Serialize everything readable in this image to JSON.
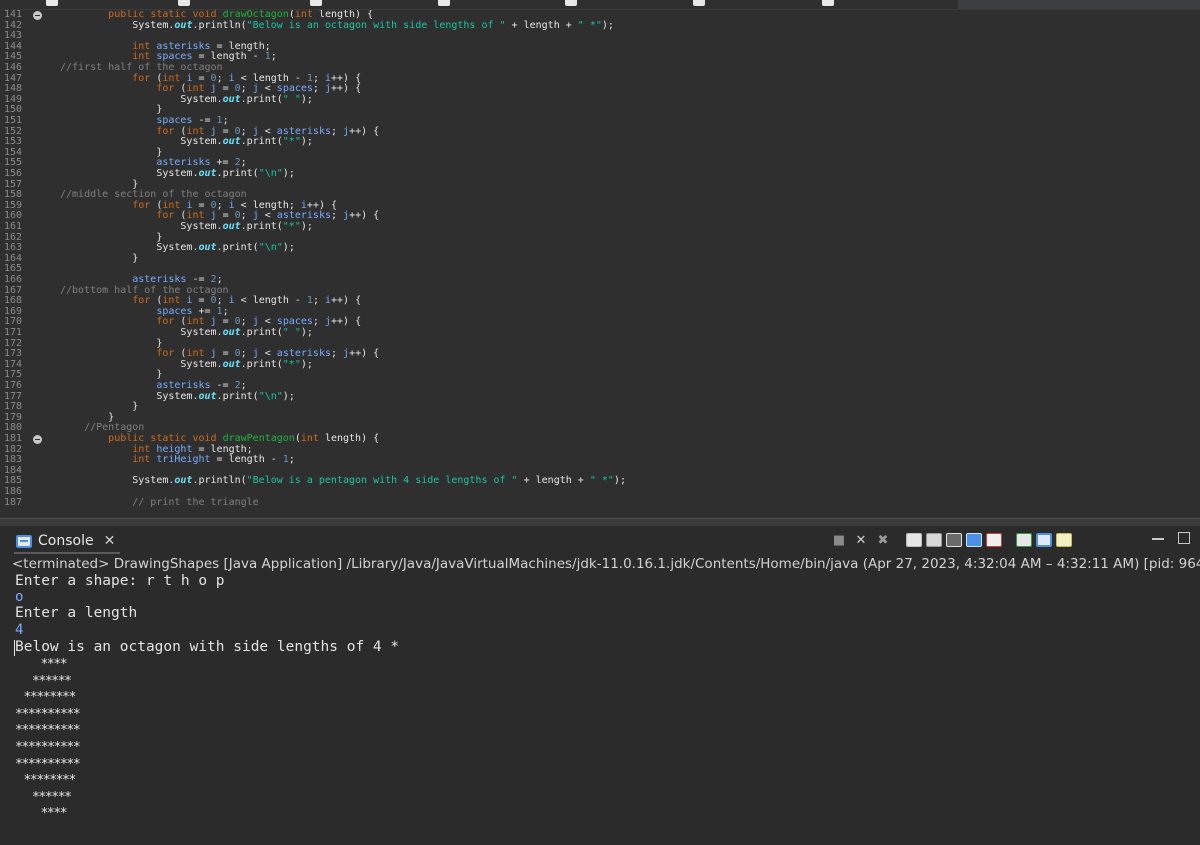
{
  "editor": {
    "lines": [
      {
        "n": "141",
        "fold": true,
        "html": "        <span class=\"kw\">public static void</span> <span class=\"fn\">drawOctagon</span>(<span class=\"ty\">int</span> length) {"
      },
      {
        "n": "142",
        "html": "            System.<span class=\"fld\">out</span>.println(<span class=\"str\">\"Below is an octagon with side lengths of \"</span> + length + <span class=\"str\">\" *\"</span>);"
      },
      {
        "n": "143",
        "html": ""
      },
      {
        "n": "144",
        "html": "            <span class=\"ty\">int</span> <span class=\"var\">asterisks</span> = length;"
      },
      {
        "n": "145",
        "html": "            <span class=\"ty\">int</span> <span class=\"var\">spaces</span> = length - <span class=\"num\">1</span>;"
      },
      {
        "n": "146",
        "html": "<span class=\"cmt\">//first half of the octagon</span>"
      },
      {
        "n": "147",
        "html": "            <span class=\"kw\">for</span> (<span class=\"ty\">int</span> <span class=\"var\">i</span> = <span class=\"num\">0</span>; <span class=\"var\">i</span> &lt; length - <span class=\"num\">1</span>; <span class=\"var\">i</span>++) {"
      },
      {
        "n": "148",
        "html": "                <span class=\"kw\">for</span> (<span class=\"ty\">int</span> <span class=\"var\">j</span> = <span class=\"num\">0</span>; <span class=\"var\">j</span> &lt; <span class=\"var\">spaces</span>; <span class=\"var\">j</span>++) {"
      },
      {
        "n": "149",
        "html": "                    System.<span class=\"fld\">out</span>.print(<span class=\"str\">\" \"</span>);"
      },
      {
        "n": "150",
        "html": "                }"
      },
      {
        "n": "151",
        "html": "                <span class=\"var\">spaces</span> -= <span class=\"num\">1</span>;"
      },
      {
        "n": "152",
        "html": "                <span class=\"kw\">for</span> (<span class=\"ty\">int</span> <span class=\"var\">j</span> = <span class=\"num\">0</span>; <span class=\"var\">j</span> &lt; <span class=\"var\">asterisks</span>; <span class=\"var\">j</span>++) {"
      },
      {
        "n": "153",
        "html": "                    System.<span class=\"fld\">out</span>.print(<span class=\"str\">\"*\"</span>);"
      },
      {
        "n": "154",
        "html": "                }"
      },
      {
        "n": "155",
        "html": "                <span class=\"var\">asterisks</span> += <span class=\"num\">2</span>;"
      },
      {
        "n": "156",
        "html": "                System.<span class=\"fld\">out</span>.print(<span class=\"str\">\"\\n\"</span>);"
      },
      {
        "n": "157",
        "html": "            }"
      },
      {
        "n": "158",
        "html": "<span class=\"cmt\">//middle section of the octagon</span>"
      },
      {
        "n": "159",
        "html": "            <span class=\"kw\">for</span> (<span class=\"ty\">int</span> <span class=\"var\">i</span> = <span class=\"num\">0</span>; <span class=\"var\">i</span> &lt; length; <span class=\"var\">i</span>++) {"
      },
      {
        "n": "160",
        "html": "                <span class=\"kw\">for</span> (<span class=\"ty\">int</span> <span class=\"var\">j</span> = <span class=\"num\">0</span>; <span class=\"var\">j</span> &lt; <span class=\"var\">asterisks</span>; <span class=\"var\">j</span>++) {"
      },
      {
        "n": "161",
        "html": "                    System.<span class=\"fld\">out</span>.print(<span class=\"str\">\"*\"</span>);"
      },
      {
        "n": "162",
        "html": "                }"
      },
      {
        "n": "163",
        "html": "                System.<span class=\"fld\">out</span>.print(<span class=\"str\">\"\\n\"</span>);"
      },
      {
        "n": "164",
        "html": "            }"
      },
      {
        "n": "165",
        "html": ""
      },
      {
        "n": "166",
        "html": "            <span class=\"var\">asterisks</span> -= <span class=\"num\">2</span>;"
      },
      {
        "n": "167",
        "html": "<span class=\"cmt\">//bottom half of the octagon</span>"
      },
      {
        "n": "168",
        "html": "            <span class=\"kw\">for</span> (<span class=\"ty\">int</span> <span class=\"var\">i</span> = <span class=\"num\">0</span>; <span class=\"var\">i</span> &lt; length - <span class=\"num\">1</span>; <span class=\"var\">i</span>++) {"
      },
      {
        "n": "169",
        "html": "                <span class=\"var\">spaces</span> += <span class=\"num\">1</span>;"
      },
      {
        "n": "170",
        "html": "                <span class=\"kw\">for</span> (<span class=\"ty\">int</span> <span class=\"var\">j</span> = <span class=\"num\">0</span>; <span class=\"var\">j</span> &lt; <span class=\"var\">spaces</span>; <span class=\"var\">j</span>++) {"
      },
      {
        "n": "171",
        "html": "                    System.<span class=\"fld\">out</span>.print(<span class=\"str\">\" \"</span>);"
      },
      {
        "n": "172",
        "html": "                }"
      },
      {
        "n": "173",
        "html": "                <span class=\"kw\">for</span> (<span class=\"ty\">int</span> <span class=\"var\">j</span> = <span class=\"num\">0</span>; <span class=\"var\">j</span> &lt; <span class=\"var\">asterisks</span>; <span class=\"var\">j</span>++) {"
      },
      {
        "n": "174",
        "html": "                    System.<span class=\"fld\">out</span>.print(<span class=\"str\">\"*\"</span>);"
      },
      {
        "n": "175",
        "html": "                }"
      },
      {
        "n": "176",
        "html": "                <span class=\"var\">asterisks</span> -= <span class=\"num\">2</span>;"
      },
      {
        "n": "177",
        "html": "                System.<span class=\"fld\">out</span>.print(<span class=\"str\">\"\\n\"</span>);"
      },
      {
        "n": "178",
        "html": "            }"
      },
      {
        "n": "179",
        "html": "        }"
      },
      {
        "n": "180",
        "html": "    <span class=\"cmt\">//Pentagon</span>"
      },
      {
        "n": "181",
        "fold": true,
        "html": "        <span class=\"kw\">public static void</span> <span class=\"fn\">drawPentagon</span>(<span class=\"ty\">int</span> length) {"
      },
      {
        "n": "182",
        "html": "            <span class=\"ty\">int</span> <span class=\"var\">height</span> = length;"
      },
      {
        "n": "183",
        "html": "            <span class=\"ty\">int</span> <span class=\"var\">triHeight</span> = length - <span class=\"num\">1</span>;"
      },
      {
        "n": "184",
        "html": ""
      },
      {
        "n": "185",
        "html": "            System.<span class=\"fld\">out</span>.println(<span class=\"str\">\"Below is a pentagon with 4 side lengths of \"</span> + length + <span class=\"str\">\" *\"</span>);"
      },
      {
        "n": "186",
        "html": ""
      },
      {
        "n": "187",
        "html": "            <span class=\"cmt\">// print the triangle</span>"
      }
    ]
  },
  "console": {
    "title": "Console",
    "close": "✕",
    "terminated_line": "<terminated> DrawingShapes [Java Application] /Library/Java/JavaVirtualMachines/jdk-11.0.16.1.jdk/Contents/Home/bin/java  (Apr 27, 2023, 4:32:04 AM – 4:32:11 AM) [pid: 96400]",
    "output": [
      {
        "text": "Enter a shape: r t h o p",
        "kind": "normal"
      },
      {
        "text": "o",
        "kind": "input"
      },
      {
        "text": "Enter a length",
        "kind": "normal"
      },
      {
        "text": "4",
        "kind": "input"
      },
      {
        "text": "Below is an octagon with side lengths of 4 *",
        "kind": "normal"
      }
    ],
    "shape": [
      "   ****",
      "  ******",
      " ********",
      "**********",
      "**********",
      "**********",
      "**********",
      " ********",
      "  ******",
      "   ****"
    ]
  },
  "toolbar": {
    "stop": "■",
    "remove": "✕",
    "remove_all": "✖"
  },
  "colors": {
    "background": "#2b2b2b",
    "keyword": "#cc6c1d",
    "string": "#17c6a3",
    "comment": "#808080",
    "variable": "#79abff",
    "method": "#1eb540",
    "input": "#79abff"
  }
}
